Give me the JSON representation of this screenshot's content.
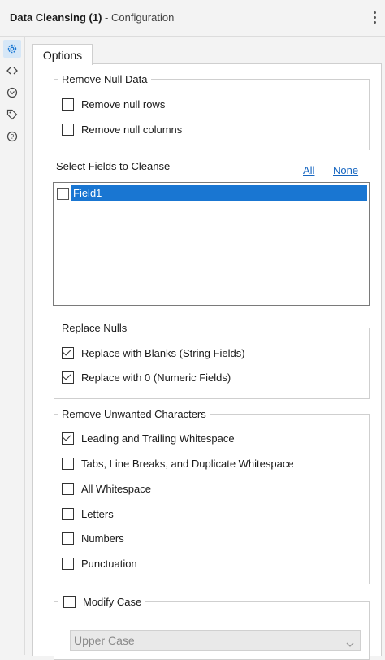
{
  "window": {
    "tool_name": "Data Cleansing (1)",
    "subtitle": "- Configuration"
  },
  "tabs": [
    {
      "label": "Options"
    }
  ],
  "remove_null_data": {
    "legend": "Remove Null Data",
    "options": [
      {
        "label": "Remove null rows",
        "checked": false
      },
      {
        "label": "Remove null columns",
        "checked": false
      }
    ]
  },
  "select_fields": {
    "label": "Select Fields to Cleanse",
    "all_link": "All",
    "none_link": "None",
    "fields": [
      {
        "label": "Field1",
        "checked": false,
        "selected": true
      }
    ]
  },
  "replace_nulls": {
    "legend": "Replace Nulls",
    "options": [
      {
        "label": "Replace with Blanks (String Fields)",
        "checked": true
      },
      {
        "label": "Replace with 0 (Numeric Fields)",
        "checked": true
      }
    ]
  },
  "remove_unwanted": {
    "legend": "Remove Unwanted Characters",
    "options": [
      {
        "label": "Leading and Trailing Whitespace",
        "checked": true
      },
      {
        "label": "Tabs, Line Breaks, and Duplicate Whitespace",
        "checked": false
      },
      {
        "label": "All Whitespace",
        "checked": false
      },
      {
        "label": "Letters",
        "checked": false
      },
      {
        "label": "Numbers",
        "checked": false
      },
      {
        "label": "Punctuation",
        "checked": false
      }
    ]
  },
  "modify_case": {
    "legend": "Modify Case",
    "checked": false,
    "dropdown_value": "Upper Case"
  },
  "icons": {
    "rail": [
      "gear-icon",
      "code-icon",
      "annotation-icon",
      "tag-icon",
      "help-icon"
    ],
    "accent": "#1976d2"
  }
}
